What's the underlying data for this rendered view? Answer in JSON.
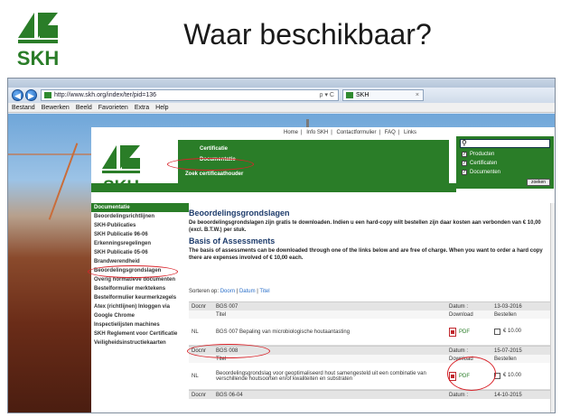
{
  "slide": {
    "title": "Waar beschikbaar?",
    "logo_text": "SKH"
  },
  "browser": {
    "url": "http://www.skh.org/index/ter/pid=136",
    "url_controls": "ρ ▾ C",
    "tab_title": "SKH",
    "tab_close": "×",
    "menu": [
      "Bestand",
      "Bewerken",
      "Beeld",
      "Favorieten",
      "Extra",
      "Help"
    ]
  },
  "site": {
    "logo_text": "SKH",
    "topnav": [
      "Home",
      "Info SKH",
      "Contactformulier",
      "FAQ",
      "Links"
    ],
    "nav": [
      "Certificatie",
      "Documentatie",
      "Zoek certificaathouder"
    ],
    "search": {
      "placeholder": "",
      "options": [
        {
          "label": "Producten",
          "checked": true
        },
        {
          "label": "Certificaten",
          "checked": true
        },
        {
          "label": "Documenten",
          "checked": true
        }
      ],
      "button": "zoeken"
    },
    "sidebar": [
      "Documentatie",
      "Beoordelingsrichtlijnen",
      "SKH-Publicaties",
      "SKH Publicatie 96-06",
      "Erkenningsregelingen",
      "SKH Publicatie 05-06",
      "Brandwerendheid",
      "Beoordelingsgrondslagen",
      "Overig normatieve documenten",
      "Bestelformulier merktekens",
      "Bestelformulier keurmerkzegels",
      "Atex (richtlijnen) Inloggen via",
      "Google Chrome",
      "Inspectielijsten machines",
      "SKH Reglement voor Certificatie",
      "Veiligheidsinstructiekaarten"
    ],
    "main": {
      "title": "Beoordelingsgrondslagen",
      "intro": "De beoordelingsgrondslagen zijn gratis te downloaden. Indien u een hard-copy wilt bestellen zijn daar kosten aan verbonden van € 10,00 (excl. B.T.W.) per stuk.",
      "title_en": "Basis of Assessments",
      "intro_en": "The basis of assessments can be downloaded through one of the links below and are free of charge. When you want to order a hard copy there are expenses involved of € 10,00 each.",
      "sort_label": "Sorteren op:",
      "sort_options": [
        "Doorn",
        "Datum",
        "Titel"
      ],
      "sort_sep": "|",
      "table": [
        {
          "doc_label": "Docnr",
          "doc_no": "BGS 007",
          "date_label": "Datum :",
          "date": "13-03-2016",
          "col_title": "Titel",
          "col_download": "Download",
          "col_order": "Bestellen",
          "lang": "NL",
          "title": "BGS 007 Bepaling van microbiologische houtaantasting",
          "download": "PDF",
          "price": "€ 10.00"
        },
        {
          "doc_label": "Docnr",
          "doc_no": "BGS 008",
          "date_label": "Datum :",
          "date": "15-07-2015",
          "col_title": "Titel",
          "col_download": "Download",
          "col_order": "Bestellen",
          "lang": "NL",
          "title": "Beoordelingsgrondslag voor geoptimaliseerd hout samengesteld uit een combinatie van verschillende houtsoorten en/of kwaliteiten en substraten",
          "download": "PDF",
          "price": "€ 10.00"
        },
        {
          "doc_label": "Docnr",
          "doc_no": "BGS 06-04",
          "date_label": "Datum :",
          "date": "14-10-2015"
        }
      ]
    }
  },
  "colors": {
    "brand_green": "#2a7d28",
    "highlight_red": "#d9232a",
    "heading_blue": "#1d3b6b"
  }
}
